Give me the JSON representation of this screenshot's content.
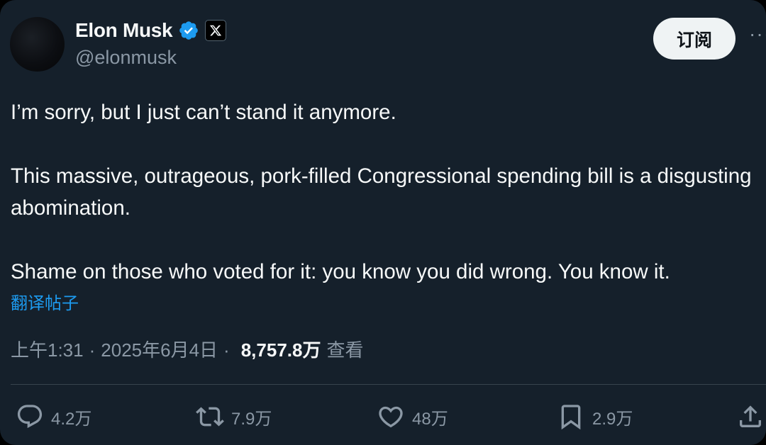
{
  "author": {
    "name": "Elon Musk",
    "handle": "@elonmusk"
  },
  "header": {
    "subscribe_label": "订阅",
    "more_label": "···"
  },
  "tweet": {
    "text": "I’m sorry, but I just can’t stand it anymore.\n\nThis massive, outrageous, pork-filled Congressional spending bill is a disgusting abomination.\n\nShame on those who voted for it: you know you did wrong. You know it.",
    "translate_label": "翻译帖子"
  },
  "meta": {
    "time": "上午1:31",
    "separator": "·",
    "date": "2025年6月4日",
    "views_count": "8,757.8万",
    "views_label": "查看"
  },
  "actions": {
    "replies": "4.2万",
    "reposts": "7.9万",
    "likes": "48万",
    "bookmarks": "2.9万"
  },
  "icons": {
    "verified": "verified-badge-icon",
    "affiliation": "x-logo-icon",
    "reply": "reply-icon",
    "repost": "repost-icon",
    "like": "heart-icon",
    "bookmark": "bookmark-icon",
    "share": "share-icon"
  },
  "colors": {
    "background": "#15202b",
    "text": "#f7f9f9",
    "secondary": "#8b98a5",
    "accent": "#1d9bf0",
    "divider": "#38444d"
  }
}
